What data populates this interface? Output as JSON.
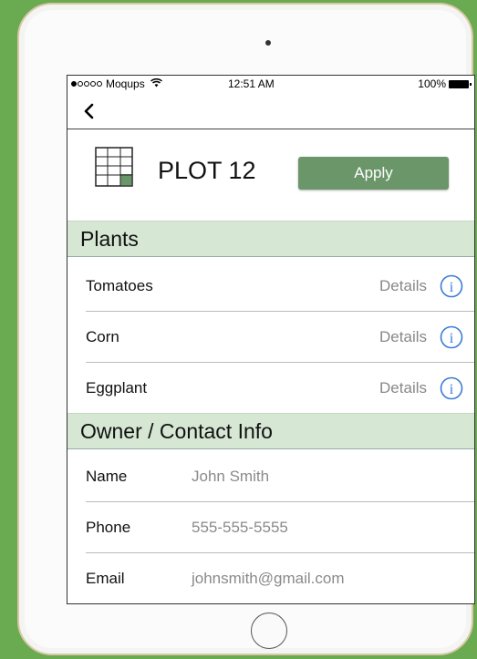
{
  "status_bar": {
    "carrier": "Moqups",
    "time": "12:51 AM",
    "battery": "100%"
  },
  "plot": {
    "title": "PLOT 12",
    "apply_label": "Apply"
  },
  "plants": {
    "header": "Plants",
    "items": [
      {
        "name": "Tomatoes",
        "details": "Details"
      },
      {
        "name": "Corn",
        "details": "Details"
      },
      {
        "name": "Eggplant",
        "details": "Details"
      }
    ]
  },
  "contact": {
    "header": "Owner / Contact Info",
    "fields": [
      {
        "label": "Name",
        "value": "John Smith"
      },
      {
        "label": "Phone",
        "value": "555-555-5555"
      },
      {
        "label": "Email",
        "value": "johnsmith@gmail.com"
      }
    ]
  },
  "colors": {
    "background": "#6aaa51",
    "apply_button": "#6a9669",
    "section_header": "#d6e8d4",
    "info_icon": "#3a7bd5"
  }
}
